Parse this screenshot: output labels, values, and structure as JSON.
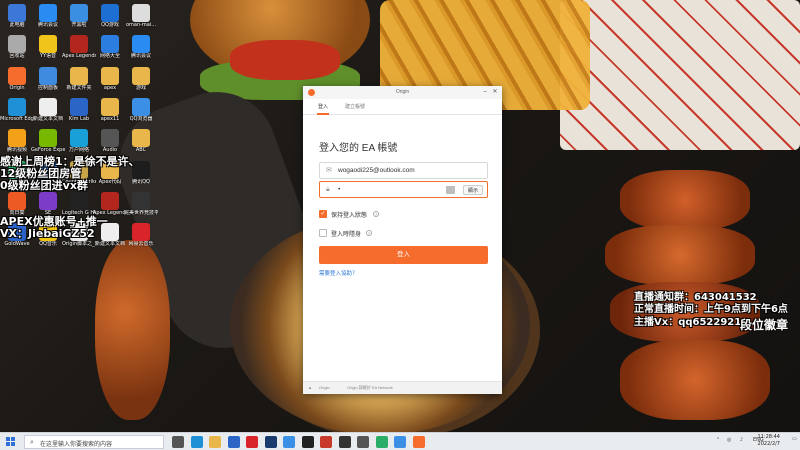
{
  "desktop": {
    "icons": [
      {
        "label": "此电脑",
        "color": "#3b78d8"
      },
      {
        "label": "腾讯会议",
        "color": "#2a8bf2"
      },
      {
        "label": "开黑啦",
        "color": "#3b8fe3"
      },
      {
        "label": "QQ游戏",
        "color": "#1d6fd1"
      },
      {
        "label": "oman-mai...",
        "color": "#dddddd"
      },
      {
        "label": "回收站",
        "color": "#aaaaaa"
      },
      {
        "label": "YY语音",
        "color": "#f0c419"
      },
      {
        "label": "Apex Legends",
        "color": "#b3261e"
      },
      {
        "label": "网络大全",
        "color": "#2c7de0"
      },
      {
        "label": "腾讯会议",
        "color": "#2a8bf2"
      },
      {
        "label": "Origin",
        "color": "#f56c2d"
      },
      {
        "label": "控制面板",
        "color": "#3e8be0"
      },
      {
        "label": "新建文件夹",
        "color": "#e8b64a"
      },
      {
        "label": "apex",
        "color": "#e8b64a"
      },
      {
        "label": "游戏",
        "color": "#e8b64a"
      },
      {
        "label": "Microsoft Edge",
        "color": "#1f8fd6"
      },
      {
        "label": "新建文本文档",
        "color": "#eeeeee"
      },
      {
        "label": "Kim Lab",
        "color": "#2b66c7"
      },
      {
        "label": "apex11",
        "color": "#e8b64a"
      },
      {
        "label": "QQ浏览器",
        "color": "#3b90e6"
      },
      {
        "label": "腾讯视频",
        "color": "#f4a11a"
      },
      {
        "label": "GeForce Experience",
        "color": "#76b900"
      },
      {
        "label": "万户网络",
        "color": "#1aa0d8"
      },
      {
        "label": "Audio",
        "color": "#555555"
      },
      {
        "label": "ABC",
        "color": "#e8b64a"
      },
      {
        "label": "微信",
        "color": "#2aae67"
      },
      {
        "label": "迅雷",
        "color": "#2f7be0"
      },
      {
        "label": "Counter-Strike: Global...",
        "color": "#c9a54a"
      },
      {
        "label": "Apex代码",
        "color": "#e8b64a"
      },
      {
        "label": "腾讯QQ",
        "color": "#1d1d1d"
      },
      {
        "label": "向日葵",
        "color": "#ee5a24"
      },
      {
        "label": "SE",
        "color": "#7d3cc7"
      },
      {
        "label": "Logitech G HUB",
        "color": "#222222"
      },
      {
        "label": "Apex Legends",
        "color": "#b3261e"
      },
      {
        "label": "完美世界竞技平台",
        "color": "#333333"
      },
      {
        "label": "GoldWave",
        "color": "#2a63c7"
      },
      {
        "label": "QQ音乐",
        "color": "#f2c511"
      },
      {
        "label": "Origin脚本之_无后坐力",
        "color": "#e9e9e9"
      },
      {
        "label": "新建文本文档",
        "color": "#eeeeee"
      },
      {
        "label": "网易云音乐",
        "color": "#d9252a"
      }
    ]
  },
  "overlay": {
    "left_lines": [
      "感谢上周榜1：是徐不是许、",
      "12级粉丝团房管",
      "0级粉丝团进vx群",
      "APEX优惠账号+推一",
      "VX：JiebaiGZ52"
    ],
    "right_lines": [
      "直播通知群：643041532",
      "正常直播时间：上午9点到下午6点",
      "主播Vx：qq6522921"
    ],
    "right_badge": "段位徽章"
  },
  "origin": {
    "window_title": "Origin",
    "tabs": [
      "登入",
      "建立帳號"
    ],
    "heading": "登入您的 EA 帳號",
    "email_value": "wogaodi225@outlook.com",
    "password_value": "•",
    "show_label": "顯示",
    "remember_label": "保持登入狀態",
    "invisible_label": "登入時隱身",
    "login_button": "登入",
    "help_link": "需要登入協助？",
    "footer_logo": "Origin",
    "footer_text": "Origin 隸屬於 EA Network"
  },
  "taskbar": {
    "search_placeholder": "在这里输入你要搜索的内容",
    "apps": [
      {
        "color": "#555555"
      },
      {
        "color": "#1f8fd6"
      },
      {
        "color": "#e8b64a"
      },
      {
        "color": "#2b66c7"
      },
      {
        "color": "#d9252a"
      },
      {
        "color": "#1a3b6e"
      },
      {
        "color": "#3b90e6"
      },
      {
        "color": "#222222"
      },
      {
        "color": "#c7392b"
      },
      {
        "color": "#333333"
      },
      {
        "color": "#555555"
      },
      {
        "color": "#2aae67"
      },
      {
        "color": "#3b90e6"
      },
      {
        "color": "#f56c2d"
      }
    ],
    "language": "ENG",
    "time": "11:28:44",
    "date": "2022/2/7"
  }
}
